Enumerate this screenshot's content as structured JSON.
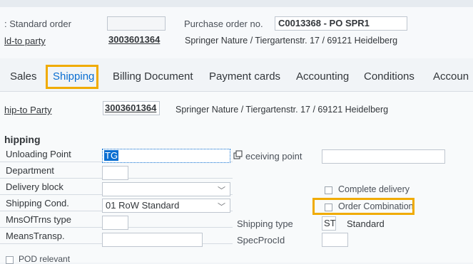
{
  "header": {
    "order_type_label": ": Standard order",
    "order_type_value": "",
    "po_label": "Purchase order no.",
    "po_value": "C0013368 - PO SPR1",
    "sold_to_label": "ld-to party",
    "sold_to_value": "3003601364",
    "sold_to_address": "Springer Nature / Tiergartenstr. 17 / 69121 Heidelberg"
  },
  "tabs": [
    {
      "label": "Sales"
    },
    {
      "label": "Shipping"
    },
    {
      "label": "Billing Document"
    },
    {
      "label": "Payment cards"
    },
    {
      "label": "Accounting"
    },
    {
      "label": "Conditions"
    },
    {
      "label": "Accoun"
    }
  ],
  "ship_to": {
    "label": "hip-to Party",
    "value": "3003601364",
    "address": "Springer Nature / Tiergartenstr. 17 / 69121 Heidelberg"
  },
  "shipping": {
    "section_title": "hipping",
    "unloading_point_label": "Unloading Point",
    "unloading_point_value": "TG",
    "receiving_point_label": "eceiving point",
    "receiving_point_value": "",
    "department_label": "Department",
    "department_value": "",
    "delivery_block_label": "Delivery block",
    "delivery_block_value": "",
    "complete_delivery_label": "Complete delivery",
    "shipping_cond_label": "Shipping Cond.",
    "shipping_cond_value": "01 RoW Standard",
    "order_combination_label": "Order Combination",
    "mns_of_trns_label": "MnsOfTrns type",
    "mns_of_trns_value": "",
    "shipping_type_label": "Shipping type",
    "shipping_type_code": "ST",
    "shipping_type_text": "Standard",
    "means_transp_label": "MeansTransp.",
    "means_transp_value": "",
    "spec_proc_label": "SpecProcId",
    "spec_proc_value": "",
    "pod_label": "POD relevant"
  },
  "icons": {
    "copy_icon": "◻︎"
  },
  "colors": {
    "highlight": "#f0ab00",
    "selected_tab": "#0a6ed1"
  }
}
